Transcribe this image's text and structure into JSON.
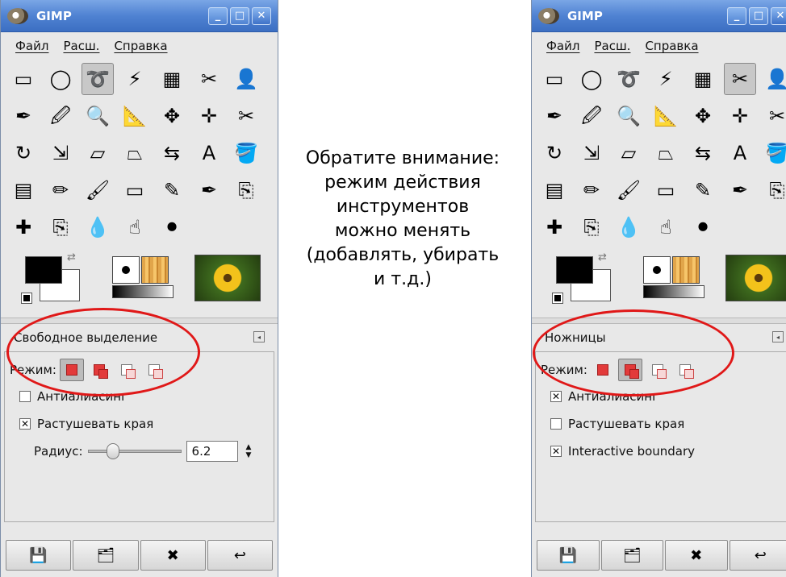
{
  "caption": {
    "lines": [
      "Обратите внимание:",
      "режим действия",
      "инструментов",
      "можно менять",
      "(добавлять, убирать",
      "и т.д.)"
    ]
  },
  "left": {
    "title": "GIMP",
    "window_buttons": [
      "_",
      "□",
      "✕"
    ],
    "menu": [
      "Файл",
      "Расш.",
      "Справка"
    ],
    "tool_icons": [
      [
        "rect-select-icon",
        "▭"
      ],
      [
        "ellipse-select-icon",
        "◯"
      ],
      [
        "free-select-icon",
        "➰"
      ],
      [
        "fuzzy-select-icon",
        "⚡"
      ],
      [
        "color-select-icon",
        "▦"
      ],
      [
        "scissors-icon",
        "✂"
      ],
      [
        "foreground-select-icon",
        "👤"
      ],
      [
        "paths-icon",
        "✒"
      ],
      [
        "color-picker-icon",
        "🖉"
      ],
      [
        "zoom-icon",
        "🔍"
      ],
      [
        "measure-icon",
        "📐"
      ],
      [
        "move-icon",
        "✥"
      ],
      [
        "align-icon",
        "✛"
      ],
      [
        "crop-icon",
        "✂"
      ],
      [
        "rotate-icon",
        "↻"
      ],
      [
        "scale-icon",
        "⇲"
      ],
      [
        "shear-icon",
        "▱"
      ],
      [
        "perspective-icon",
        "⏢"
      ],
      [
        "flip-icon",
        "⇆"
      ],
      [
        "text-icon",
        "A"
      ],
      [
        "bucket-fill-icon",
        "🪣"
      ],
      [
        "blend-icon",
        "▤"
      ],
      [
        "pencil-icon",
        "✏"
      ],
      [
        "paintbrush-icon",
        "🖌"
      ],
      [
        "eraser-icon",
        "▭"
      ],
      [
        "airbrush-icon",
        "✎"
      ],
      [
        "ink-icon",
        "✒"
      ],
      [
        "clone-icon",
        "⎘"
      ],
      [
        "heal-icon",
        "✚"
      ],
      [
        "perspective-clone-icon",
        "⎘"
      ],
      [
        "blur-icon",
        "💧"
      ],
      [
        "smudge-icon",
        "☝"
      ],
      [
        "dodge-burn-icon",
        "⚫"
      ]
    ],
    "selected_tool": 2,
    "options_title": "Свободное выделение",
    "collapse_glyph": "◂",
    "mode_label": "Режим:",
    "selected_mode": 0,
    "checks": [
      {
        "label": "Антиалиасинг",
        "checked": false
      },
      {
        "label": "Растушевать края",
        "checked": true
      }
    ],
    "radius_label": "Радиус:",
    "radius_value": "6.2",
    "slider_fraction": 0.2,
    "bottom_buttons": [
      [
        "save-icon",
        "💾"
      ],
      [
        "restore-icon",
        "🗂"
      ],
      [
        "delete-icon",
        "✖"
      ],
      [
        "reset-icon",
        "↩"
      ]
    ]
  },
  "right": {
    "title": "GIMP",
    "window_buttons": [
      "_",
      "□",
      "✕"
    ],
    "menu": [
      "Файл",
      "Расш.",
      "Справка"
    ],
    "tool_icons": [
      [
        "rect-select-icon",
        "▭"
      ],
      [
        "ellipse-select-icon",
        "◯"
      ],
      [
        "free-select-icon",
        "➰"
      ],
      [
        "fuzzy-select-icon",
        "⚡"
      ],
      [
        "color-select-icon",
        "▦"
      ],
      [
        "scissors-icon",
        "✂"
      ],
      [
        "foreground-select-icon",
        "👤"
      ],
      [
        "paths-icon",
        "✒"
      ],
      [
        "color-picker-icon",
        "🖉"
      ],
      [
        "zoom-icon",
        "🔍"
      ],
      [
        "measure-icon",
        "📐"
      ],
      [
        "move-icon",
        "✥"
      ],
      [
        "align-icon",
        "✛"
      ],
      [
        "crop-icon",
        "✂"
      ],
      [
        "rotate-icon",
        "↻"
      ],
      [
        "scale-icon",
        "⇲"
      ],
      [
        "shear-icon",
        "▱"
      ],
      [
        "perspective-icon",
        "⏢"
      ],
      [
        "flip-icon",
        "⇆"
      ],
      [
        "text-icon",
        "A"
      ],
      [
        "bucket-fill-icon",
        "🪣"
      ],
      [
        "blend-icon",
        "▤"
      ],
      [
        "pencil-icon",
        "✏"
      ],
      [
        "paintbrush-icon",
        "🖌"
      ],
      [
        "eraser-icon",
        "▭"
      ],
      [
        "airbrush-icon",
        "✎"
      ],
      [
        "ink-icon",
        "✒"
      ],
      [
        "clone-icon",
        "⎘"
      ],
      [
        "heal-icon",
        "✚"
      ],
      [
        "perspective-clone-icon",
        "⎘"
      ],
      [
        "blur-icon",
        "💧"
      ],
      [
        "smudge-icon",
        "☝"
      ],
      [
        "dodge-burn-icon",
        "⚫"
      ]
    ],
    "selected_tool": 5,
    "options_title": "Ножницы",
    "collapse_glyph": "◂",
    "mode_label": "Режим:",
    "selected_mode": 1,
    "checks": [
      {
        "label": "Антиалиасинг",
        "checked": true
      },
      {
        "label": "Растушевать края",
        "checked": false
      },
      {
        "label": "Interactive boundary",
        "checked": true
      }
    ],
    "bottom_buttons": [
      [
        "save-icon",
        "💾"
      ],
      [
        "restore-icon",
        "🗂"
      ],
      [
        "delete-icon",
        "✖"
      ],
      [
        "reset-icon",
        "↩"
      ]
    ]
  },
  "colors": {
    "highlight_ring": "#e01818",
    "titlebar": "#4f82d2"
  }
}
